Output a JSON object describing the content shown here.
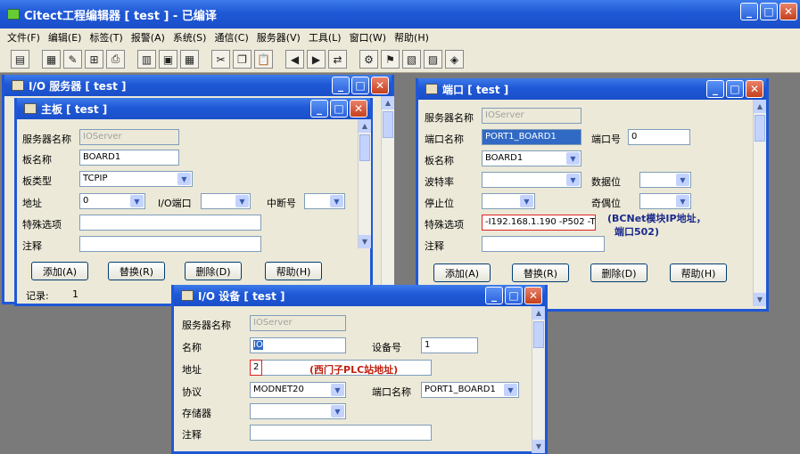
{
  "main_window": {
    "title": "Citect工程编辑器 [ test ] - 已编译"
  },
  "menu": [
    "文件(F)",
    "编辑(E)",
    "标签(T)",
    "报警(A)",
    "系统(S)",
    "通信(C)",
    "服务器(V)",
    "工具(L)",
    "窗口(W)",
    "帮助(H)"
  ],
  "toolbar_icons": [
    "page-icon",
    "new-icon",
    "wand-icon",
    "tree-icon",
    "print-icon",
    "grid-icon",
    "db-icon",
    "table-icon",
    "cut-icon",
    "copy-icon",
    "paste-icon",
    "prev-icon",
    "next-icon",
    "link-icon",
    "tool-icon",
    "flag-icon",
    "chart-icon",
    "plot-icon",
    "tag-icon"
  ],
  "io_server": {
    "title": "I/O 服务器 [ test ]"
  },
  "board": {
    "title": "主板 [ test ]",
    "server_label": "服务器名称",
    "server_value": "IOServer",
    "name_label": "板名称",
    "name_value": "BOARD1",
    "type_label": "板类型",
    "type_value": "TCPIP",
    "addr_label": "地址",
    "addr_value": "0",
    "ioport_label": "I/O端口",
    "ioport_value": "",
    "irq_label": "中断号",
    "irq_value": "",
    "special_label": "特殊选项",
    "special_value": "",
    "comment_label": "注释",
    "comment_value": "",
    "buttons": {
      "add": "添加(A)",
      "replace": "替换(R)",
      "delete": "删除(D)",
      "help": "帮助(H)"
    },
    "records_label": "记录:",
    "records_value": "1"
  },
  "port": {
    "title": "端口 [ test ]",
    "server_label": "服务器名称",
    "server_value": "IOServer",
    "port_name_label": "端口名称",
    "port_name_value": "PORT1_BOARD1",
    "port_no_label": "端口号",
    "port_no_value": "0",
    "board_label": "板名称",
    "board_value": "BOARD1",
    "baud_label": "波特率",
    "baud_value": "",
    "databits_label": "数据位",
    "databits_value": "",
    "stopbits_label": "停止位",
    "stopbits_value": "",
    "parity_label": "奇偶位",
    "parity_value": "",
    "special_label": "特殊选项",
    "special_value": "-I192.168.1.190 -P502 -T",
    "comment_label": "注释",
    "comment_value": "",
    "note_line1": "(BCNet模块IP地址，",
    "note_line2": "端口502)",
    "buttons": {
      "add": "添加(A)",
      "replace": "替换(R)",
      "delete": "删除(D)",
      "help": "帮助(H)"
    }
  },
  "device": {
    "title": "I/O 设备 [ test ]",
    "server_label": "服务器名称",
    "server_value": "IOServer",
    "name_label": "名称",
    "name_value": "IO",
    "devno_label": "设备号",
    "devno_value": "1",
    "addr_label": "地址",
    "addr_value": "2",
    "addr_note": "(西门子PLC站地址)",
    "protocol_label": "协议",
    "protocol_value": "MODNET20",
    "portname_label": "端口名称",
    "portname_value": "PORT1_BOARD1",
    "storage_label": "存储器",
    "storage_value": "",
    "comment_label": "注释",
    "comment_value": ""
  },
  "colors": {
    "titlebar": "#1f58d6",
    "dialog_bg": "#ece9d8",
    "desktop": "#7a7a7a",
    "note_red": "#c02010"
  }
}
